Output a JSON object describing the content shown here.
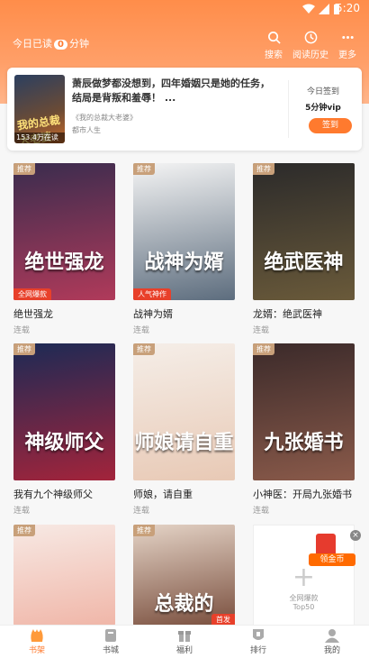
{
  "status_bar": {
    "time": "5:20"
  },
  "header": {
    "read_prefix": "今日已读",
    "read_minutes": "0",
    "read_suffix": "分钟",
    "buttons": [
      {
        "label": "搜索",
        "icon": "search-icon"
      },
      {
        "label": "阅读历史",
        "icon": "history-icon"
      },
      {
        "label": "更多",
        "icon": "more-icon"
      }
    ]
  },
  "featured": {
    "cover_badge": "153.4万在读",
    "cover_title": "我的总裁大老婆",
    "intro": "萧辰做梦都没想到，四年婚姻只是她的任务，结局是背叛和羞辱！ ...",
    "source": "《我的总裁大老婆》",
    "category": "都市人生",
    "checkin_label": "今日签到",
    "vip_text": "5分钟vip",
    "sign_button": "签到"
  },
  "books": [
    {
      "title": "绝世强龙",
      "status": "连载",
      "tag": "推荐",
      "label": "全网爆款",
      "cover_text": "绝世强龙",
      "c1": "#3a2c4e",
      "c2": "#b03a5a"
    },
    {
      "title": "战神为婿",
      "status": "连载",
      "tag": "推荐",
      "label": "人气神作",
      "cover_text": "战神为婿",
      "c1": "#f4f4f4",
      "c2": "#5d6d7e"
    },
    {
      "title": "龙婿：绝武医神",
      "status": "连载",
      "tag": "推荐",
      "label": "",
      "cover_text": "绝武医神",
      "c1": "#2b2a2a",
      "c2": "#6a5a3a"
    },
    {
      "title": "我有九个神级师父",
      "status": "连载",
      "tag": "推荐",
      "label": "",
      "cover_text": "神级师父",
      "c1": "#1c2a55",
      "c2": "#a3243b"
    },
    {
      "title": "师娘，请自重",
      "status": "连载",
      "tag": "推荐",
      "label": "",
      "cover_text": "师娘请自重",
      "c1": "#f5eee8",
      "c2": "#e8c9b5"
    },
    {
      "title": "小神医：开局九张婚书",
      "status": "连载",
      "tag": "推荐",
      "label": "",
      "cover_text": "九张婚书",
      "c1": "#3b2a2a",
      "c2": "#8a5a4a"
    },
    {
      "title": "",
      "status": "",
      "tag": "推荐",
      "label": "",
      "cover_text": "",
      "c1": "#f7e9e4",
      "c2": "#f0b6a8"
    },
    {
      "title": "",
      "status": "",
      "tag": "推荐",
      "label": "首发",
      "cover_text": "总裁的",
      "c1": "#e4d3c6",
      "c2": "#7a4f3e"
    }
  ],
  "promo": {
    "line1": "全网爆款",
    "line2": "Top50",
    "coin_label": "领金币"
  },
  "tabs": [
    {
      "label": "书架",
      "icon": "bookshelf-icon",
      "active": true
    },
    {
      "label": "书城",
      "icon": "bookstore-icon",
      "active": false
    },
    {
      "label": "福利",
      "icon": "gift-icon",
      "active": false
    },
    {
      "label": "排行",
      "icon": "rank-icon",
      "active": false
    },
    {
      "label": "我的",
      "icon": "user-icon",
      "active": false
    }
  ]
}
